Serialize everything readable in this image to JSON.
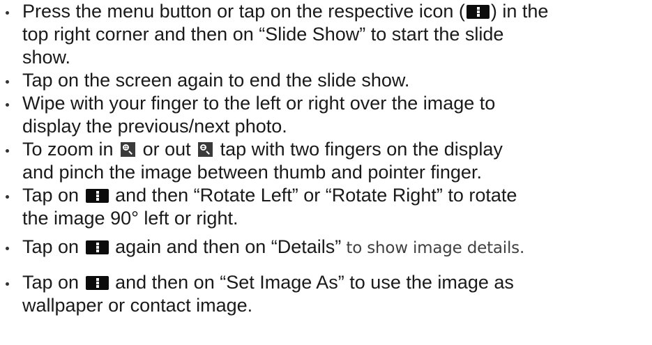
{
  "instructions": [
    {
      "lines": [
        [
          "Press the menu button or tap on the respective icon (",
          "menu-icon",
          ") in the"
        ],
        [
          "top right corner and then on “Slide Show” to start the slide"
        ],
        [
          "show."
        ]
      ]
    },
    {
      "lines": [
        [
          "Tap on the screen again to end the slide show."
        ]
      ]
    },
    {
      "lines": [
        [
          "Wipe with your finger to the left or right over the image to"
        ],
        [
          "display the previous/next photo."
        ]
      ]
    },
    {
      "lines": [
        [
          "To zoom in ",
          "zoom-in-icon",
          " or out ",
          "zoom-out-icon",
          " tap with two fingers on the display"
        ],
        [
          "and pinch the image between thumb and pointer finger."
        ]
      ]
    },
    {
      "lines": [
        [
          "Tap on ",
          "menu-icon",
          " and then “Rotate Left” or “Rotate Right” to rotate"
        ],
        [
          "the image 90° left or right."
        ]
      ]
    },
    {
      "lines": [
        [
          "Tap on ",
          "menu-icon",
          " again and then on “Details”",
          {
            "tail": " to show image details."
          }
        ]
      ]
    },
    {
      "lines": [
        [
          "Tap on ",
          "menu-icon",
          " and then on “Set Image As” to use the image as"
        ],
        [
          "wallpaper or contact image."
        ]
      ]
    }
  ]
}
